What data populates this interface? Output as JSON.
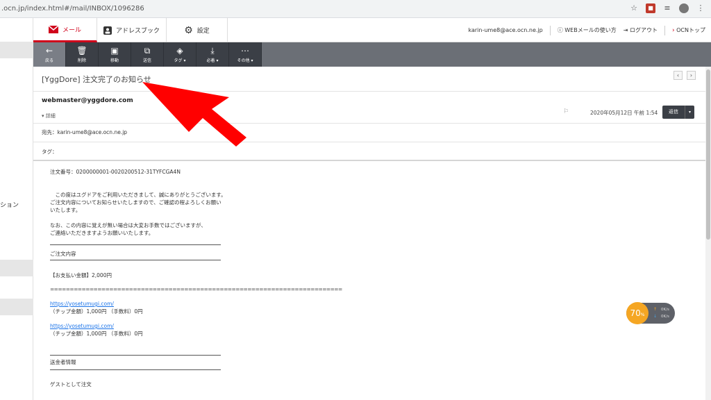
{
  "browser": {
    "url": ".ocn.jp/index.html#/mail/INBOX/1096286",
    "icons": [
      "star-icon",
      "extension-icon",
      "reading-list-icon",
      "profile-avatar",
      "menu-icon"
    ]
  },
  "sidebar": {
    "partial_label": "ション"
  },
  "tabs": [
    {
      "label": "メール",
      "icon": "mail-icon",
      "active": true
    },
    {
      "label": "アドレスブック",
      "icon": "address-book-icon",
      "active": false
    },
    {
      "label": "設定",
      "icon": "gear-icon",
      "active": false
    }
  ],
  "user": {
    "email": "karin-ume8@ace.ocn.ne.jp",
    "help": "WEBメールの使い方",
    "logout": "ログアウト",
    "top": "OCNトップ"
  },
  "toolbar": {
    "back": "戻る",
    "delete": "削除",
    "move": "移動",
    "forward": "送信",
    "tag": "タグ",
    "important": "必着",
    "more": "その他"
  },
  "message": {
    "subject": "[YggDore] 注文完了のお知らせ",
    "sender": "webmaster@yggdore.com",
    "details_label": "詳細",
    "date": "2020年05月12日 午前 1:54",
    "reply_label": "返信",
    "to_label": "宛先：",
    "to_value": "karin-ume8@ace.ocn.ne.jp",
    "tag_label": "タグ："
  },
  "body": {
    "order_no": "注文番号：0200000001-0020200512-31TYFCGA4N",
    "greeting_1": "　この度はユグドアをご利用いただきまして、誠にありがとうございます。",
    "greeting_2": "ご注文内容についてお知らせいたしますので、ご確認の程よろしくお願い",
    "greeting_3": "いたします。",
    "notice_1": "なお、この内容に覚えが無い場合は大変お手数ではございますが、",
    "notice_2": "ご連絡いただきますようお願いいたします。",
    "section_order": "ご注文内容",
    "payment": "【お支払い金額】2,000円",
    "equals_rule": "==========================================================================",
    "link_1": "https://yosetumugi.com/",
    "item_1": "（チップ金額）1,000円 （手数料）0円",
    "link_2": "https://yosetumugi.com/",
    "item_2": "（チップ金額）1,000円 （手数料）0円",
    "section_sender": "送金者情報",
    "guest": "ゲストとして注文"
  },
  "widget": {
    "percent": "70",
    "percent_unit": "%",
    "up": "0K/s",
    "down": "0K/s"
  },
  "colors": {
    "accent_red": "#d0021b",
    "toolbar_dark": "#3b3f46",
    "toolbar_bg": "#6b6f76",
    "widget_orange": "#f5a623"
  }
}
